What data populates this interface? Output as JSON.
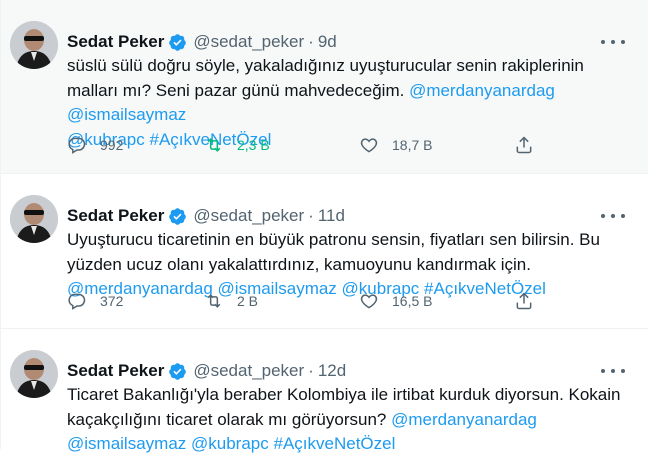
{
  "tweets": [
    {
      "name": "Sedat Peker",
      "handle": "@sedat_peker",
      "separator": "·",
      "time": "9d",
      "body": {
        "t1": "süslü sülü doğru söyle, yakaladığınız uyuşturucular senin rakiplerinin malları mı? Seni pazar günü mahvedeceğim. ",
        "m1": "@merdanyanardag",
        "s1": " ",
        "m2": "@ismailsaymaz",
        "s2": " ",
        "m3": "@kubrapc",
        "s3": " ",
        "h1": "#AçıkveNetÖzel"
      },
      "stats": {
        "replies": "992",
        "retweets": "2,3 B",
        "likes": "18,7 B"
      },
      "retweeted": true
    },
    {
      "name": "Sedat Peker",
      "handle": "@sedat_peker",
      "separator": "·",
      "time": "11d",
      "body": {
        "t1": "Uyuşturucu ticaretinin en büyük patronu sensin, fiyatları sen bilirsin. Bu yüzden ucuz olanı yakalattırdınız, kamuoyunu kandırmak için. ",
        "m1": "@merdanyanardag",
        "s1": " ",
        "m2": "@ismailsaymaz",
        "s2": " ",
        "m3": "@kubrapc",
        "s3": " ",
        "h1": "#AçıkveNetÖzel"
      },
      "stats": {
        "replies": "372",
        "retweets": "2 B",
        "likes": "16,5 B"
      },
      "retweeted": false
    },
    {
      "name": "Sedat Peker",
      "handle": "@sedat_peker",
      "separator": "·",
      "time": "12d",
      "body": {
        "t1": "Ticaret Bakanlığı'yla beraber Kolombiya ile irtibat kurduk diyorsun. Kokain kaçakçılığını ticaret olarak mı görüyorsun? ",
        "m1": "@merdanyanardag",
        "s1": " ",
        "m2": "@ismailsaymaz",
        "s2": " ",
        "m3": "@kubrapc",
        "s3": " ",
        "h1": "#AçıkveNetÖzel"
      }
    }
  ],
  "colors": {
    "link": "#1d9bf0",
    "muted": "#536471",
    "retweet_active": "#00ba7c",
    "highlight_bg": "#f7f9f9"
  },
  "icons": [
    "avatar",
    "verified-badge-icon",
    "more-icon",
    "reply-icon",
    "retweet-icon",
    "like-icon",
    "share-icon"
  ]
}
